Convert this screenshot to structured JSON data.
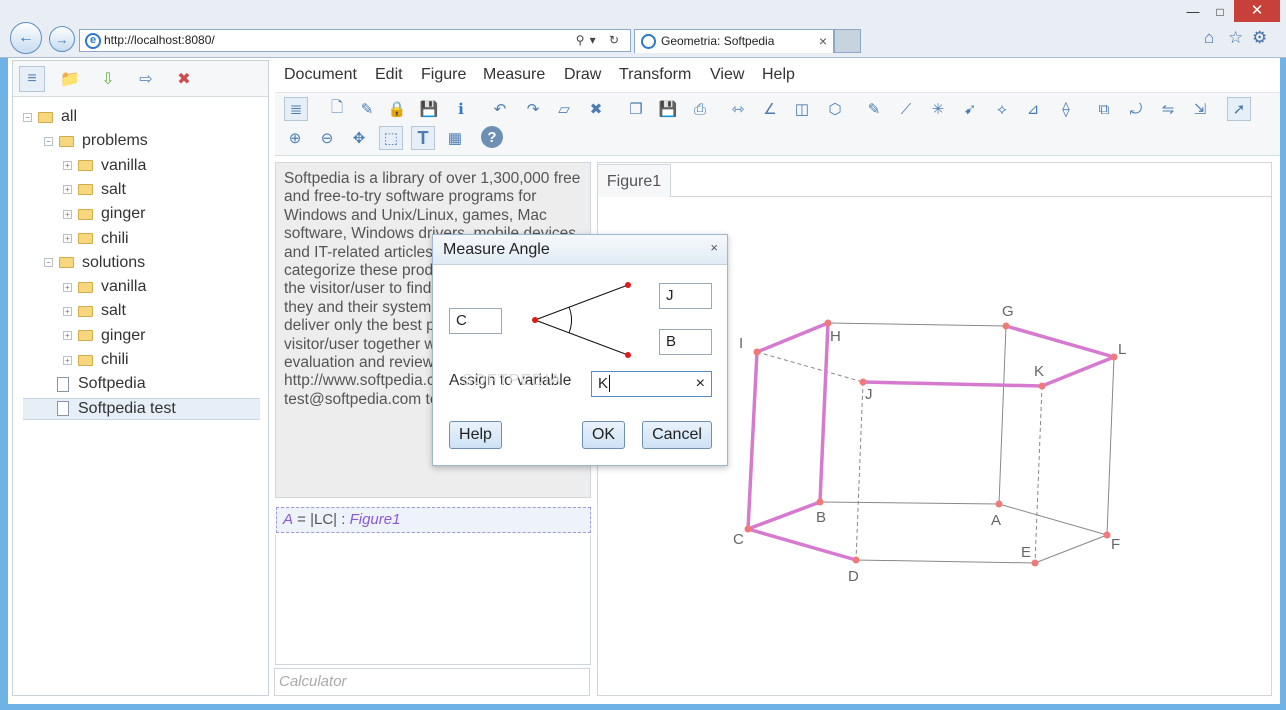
{
  "browser": {
    "url": "http://localhost:8080/",
    "tab_title": "Geometria: Softpedia",
    "tab_close": "×"
  },
  "left_panel": {
    "tree": [
      {
        "label": "all",
        "pm": "−",
        "depth": 0,
        "kind": "folder"
      },
      {
        "label": "problems",
        "pm": "−",
        "depth": 1,
        "kind": "folder"
      },
      {
        "label": "vanilla",
        "pm": "+",
        "depth": 2,
        "kind": "folder"
      },
      {
        "label": "salt",
        "pm": "+",
        "depth": 2,
        "kind": "folder"
      },
      {
        "label": "ginger",
        "pm": "+",
        "depth": 2,
        "kind": "folder"
      },
      {
        "label": "chili",
        "pm": "+",
        "depth": 2,
        "kind": "folder"
      },
      {
        "label": "solutions",
        "pm": "−",
        "depth": 1,
        "kind": "folder"
      },
      {
        "label": "vanilla",
        "pm": "+",
        "depth": 2,
        "kind": "folder"
      },
      {
        "label": "salt",
        "pm": "+",
        "depth": 2,
        "kind": "folder"
      },
      {
        "label": "ginger",
        "pm": "+",
        "depth": 2,
        "kind": "folder"
      },
      {
        "label": "chili",
        "pm": "+",
        "depth": 2,
        "kind": "folder"
      },
      {
        "label": "Softpedia",
        "pm": "",
        "depth": 1,
        "kind": "doc"
      },
      {
        "label": "Softpedia test",
        "pm": "",
        "depth": 1,
        "kind": "doc",
        "selected": true
      }
    ]
  },
  "menu": [
    "Document",
    "Edit",
    "Figure",
    "Measure",
    "Draw",
    "Transform",
    "View",
    "Help"
  ],
  "text_content": "Softpedia is a library of over 1,300,000 free and free-to-try software programs for Windows and Unix/Linux, games, Mac software, Windows drivers, mobile devices and IT-related articles. We review and categorize these products in order to allow the visitor/user to find the exact product they and their system needs. We strive to deliver only the best products to the visitor/user together with self-made evaluation and review notes. Softpedia test http://www.softpedia.com test@softpedia.com tester@softpedia.com",
  "formula": {
    "var": "A",
    "eq": " = |LC| : ",
    "fig": "Figure1"
  },
  "calculator_placeholder": "Calculator",
  "figure_tab": "Figure1",
  "dialog": {
    "title": "Measure Angle",
    "close": "×",
    "point1": "C",
    "point2": "J",
    "point3": "B",
    "assign_label": "Assign to variable",
    "variable_value": "K",
    "clear": "×",
    "help": "Help",
    "ok": "OK",
    "cancel": "Cancel",
    "watermark": "SOFTPEDIA"
  },
  "figure_points": [
    "A",
    "B",
    "C",
    "D",
    "E",
    "F",
    "G",
    "H",
    "I",
    "J",
    "K",
    "L"
  ],
  "colors": {
    "highlight_edge": "#d67ad0",
    "point": "#f07a7a",
    "edge": "#888888"
  }
}
